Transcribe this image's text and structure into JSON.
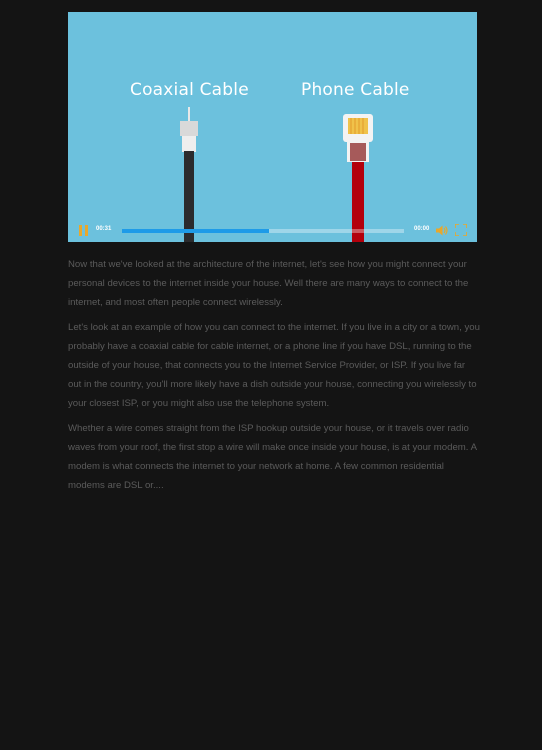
{
  "video": {
    "label_left": "Coaxial Cable",
    "label_right": "Phone Cable",
    "current_time": "00:31",
    "duration": "00:00",
    "progress": 0.52,
    "colors": {
      "background": "#6cc1dd",
      "accent": "#e8a82c",
      "progress": "#1e9be8"
    },
    "icons": [
      "pause-icon",
      "volume-icon",
      "fullscreen-icon"
    ]
  },
  "article": {
    "paragraphs": [
      "Now that we've looked at the architecture of the internet, let's see how you might  connect your personal devices to the internet inside your house.  Well there are many ways to connect to the internet, and  most often people connect wirelessly.",
      "Let's look at an example of how you can connect to the internet.  If you live in a city or a town, you probably have a coaxial cable for  cable internet, or a phone line if you have DSL, running to the outside of  your house, that connects you to the Internet Service Provider, or ISP.  If you live far out in the country, you'll more likely have  a dish outside your house, connecting you wirelessly to your closest ISP, or  you might also use the telephone system.",
      "Whether a wire comes straight from the ISP hookup outside your house, or  it travels over radio waves from your roof,  the first stop a wire will make once inside your house, is at your modem.  A modem is what connects the internet to your network at home.  A few common residential modems are DSL or...."
    ]
  }
}
